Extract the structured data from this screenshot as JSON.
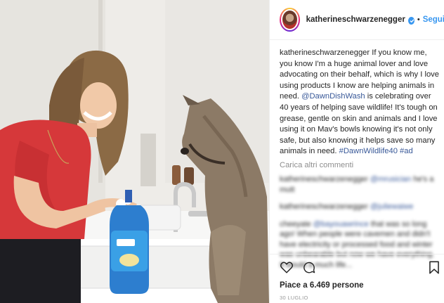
{
  "post": {
    "username": "katherineschwarzenegger",
    "separator": "•",
    "follow_label": "Segui",
    "caption": {
      "username": "katherineschwarzenegger",
      "text_1": " If you know me, you know I'm a huge animal lover and love advocating on their behalf, which is why I love using products I know are helping animals in need. ",
      "mention": "@DawnDishWash",
      "text_2": " is celebrating over 40 years of helping save wildlife! It's tough on grease, gentle on skin and animals and I love using it on Mav's bowls knowing it's not only safe, but also knowing it helps save so many animals in need. ",
      "hashtag_1": "#DawnWildlife40",
      "space": " ",
      "hashtag_2": "#ad"
    },
    "load_more_label": "Carica altri commenti",
    "likes_label": "Piace a 6.469 persone",
    "date_label": "30 LUGLIO"
  },
  "comments_blurred": [
    {
      "user": "katherineschwarzenegger",
      "mention": "@mrusician",
      "text": " he's a mutt"
    },
    {
      "user": "katherineschwarzenegger",
      "mention": "@juliewaiwe",
      "text": ""
    },
    {
      "user": "cheeyate",
      "mention": "@bayouawrince",
      "text": " that was so long ago! When people were cavemen and didn't have electricity or processed food and winter was unbearable but now we have everything. It would a much life..."
    }
  ],
  "icons": {
    "verified": "verified-badge-icon",
    "like": "heart-icon",
    "comment": "comment-icon",
    "save": "bookmark-icon"
  },
  "colors": {
    "link": "#3897f0",
    "tag": "#385898",
    "muted": "#8e8e8e"
  }
}
